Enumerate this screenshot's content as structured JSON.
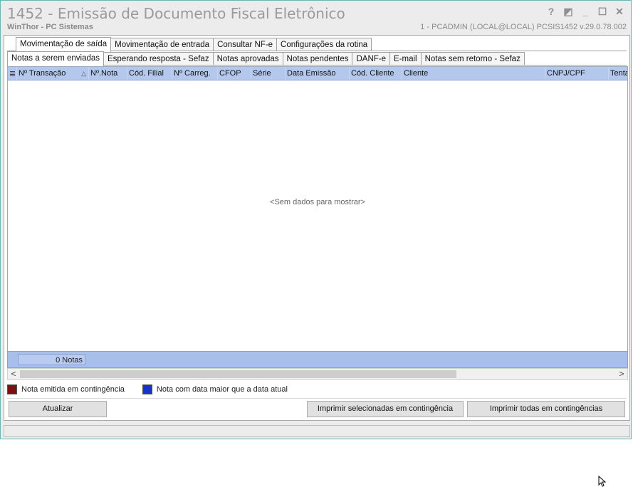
{
  "window": {
    "title": "1452 - Emissão de Documento Fiscal Eletrônico",
    "subtitle": "WinThor - PC Sistemas",
    "userinfo": "1 - PCADMIN (LOCAL@LOCAL)   PCSIS1452  v.29.0.78.002",
    "controls": [
      "?",
      "◩",
      "_",
      "☐",
      "✕"
    ]
  },
  "tabs_main": [
    {
      "label": "Movimentação de saída",
      "active": true
    },
    {
      "label": "Movimentação de entrada",
      "active": false
    },
    {
      "label": "Consultar NF-e",
      "active": false
    },
    {
      "label": "Configurações da rotina",
      "active": false
    }
  ],
  "tabs_sub": [
    {
      "label": "Notas a serem enviadas",
      "active": true
    },
    {
      "label": "Esperando resposta - Sefaz",
      "active": false
    },
    {
      "label": "Notas aprovadas",
      "active": false
    },
    {
      "label": "Notas pendentes",
      "active": false
    },
    {
      "label": "DANF-e",
      "active": false
    },
    {
      "label": "E-mail",
      "active": false
    },
    {
      "label": "Notas sem retorno - Sefaz",
      "active": false
    }
  ],
  "grid": {
    "columns": [
      "Nº Transação",
      "Nº.Nota",
      "Cód. Filial",
      "Nº Carreg.",
      "CFOP",
      "Série",
      "Data Emissão",
      "Cód. Cliente",
      "Cliente",
      "CNPJ/CPF",
      "Tenta"
    ],
    "sort_indicator": "△",
    "empty_text": "<Sem dados para mostrar>",
    "footer_count": "0 Notas"
  },
  "legend": [
    {
      "label": "Nota emitida em contingência",
      "color": "#7a1010"
    },
    {
      "label": "Nota com data maior que a data atual",
      "color": "#1a2fd0"
    }
  ],
  "buttons": {
    "refresh": "Atualizar",
    "print_selected": "Imprimir selecionadas em contingência",
    "print_all": "Imprimir todas em contingências"
  },
  "scroll_arrows": {
    "left": "<",
    "right": ">"
  }
}
